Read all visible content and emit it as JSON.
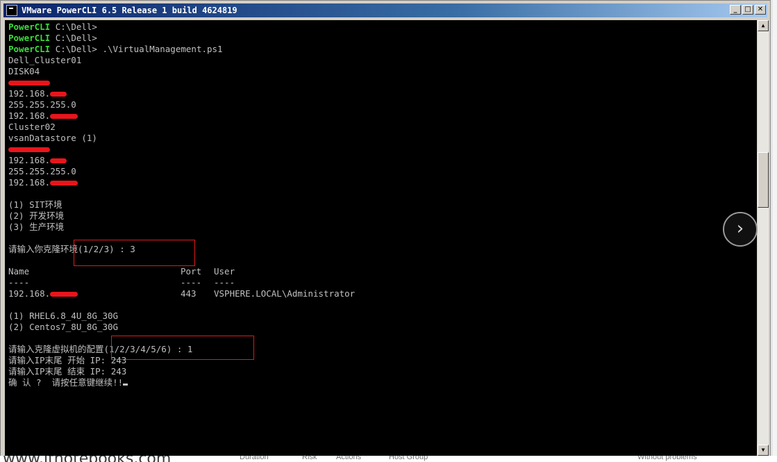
{
  "window": {
    "title": "VMware PowerCLI 6.5 Release 1 build 4624819",
    "minimize_glyph": "_",
    "maximize_glyph": "□",
    "close_glyph": "✕"
  },
  "console": {
    "prompt_label": "PowerCLI",
    "prompt_path": " C:\\Dell>",
    "command": " .\\VirtualManagement.ps1",
    "block1": [
      "Dell_Cluster01",
      "DISK04"
    ],
    "ip_prefix": "192.168.",
    "netmask": "255.255.255.0",
    "cluster2": "Cluster02",
    "datastore": "vsanDatastore (1)",
    "env_options": [
      "(1) SIT环境",
      "(2) 开发环境",
      "(3) 生产环境"
    ],
    "env_prompt_prefix": "请输入你克隆",
    "env_prompt_boxed": "环境(1/2/3) : 3",
    "table_headers": {
      "name": "Name",
      "port": "Port",
      "user": "User"
    },
    "table_dashes": {
      "name": "----",
      "port": "----",
      "user": "----"
    },
    "table_row": {
      "port": "443",
      "user": "VSPHERE.LOCAL\\Administrator"
    },
    "template_options": [
      "(1) RHEL6.8_4U_8G_30G",
      "(2) Centos7_8U_8G_30G"
    ],
    "config_prompt_prefix": "请输入克隆虚拟机的",
    "config_prompt_boxed": "配置(1/2/3/4/5/6) : 1",
    "ip_start": "请输入IP末尾 开始 IP: 243",
    "ip_end": "请输入IP末尾 结束 IP: 243",
    "confirm": "确 认 ?  请按任意键继续!!"
  },
  "scrollbar": {
    "up_glyph": "▲",
    "down_glyph": "▼"
  },
  "overlay": {
    "next_glyph": "›"
  },
  "footer": {
    "watermark": "www.itnotebooks.com",
    "hints": [
      "Duration",
      "Risk",
      "Actions",
      "Host Group",
      "Without problems"
    ]
  },
  "colors": {
    "console_bg": "#000000",
    "console_text": "#c0c0c0",
    "prompt_green": "#3ade3a",
    "redaction_red": "#e8151b",
    "title_blue": "#0a246a"
  }
}
